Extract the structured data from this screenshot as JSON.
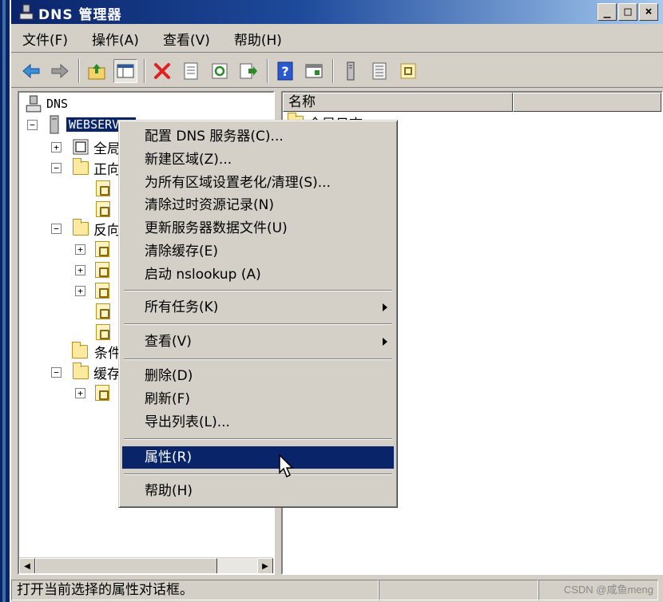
{
  "window": {
    "title": "DNS 管理器",
    "controls": {
      "minimize": "_",
      "maximize": "□",
      "close": "×"
    }
  },
  "menubar": {
    "items": [
      "文件(F)",
      "操作(A)",
      "查看(V)",
      "帮助(H)"
    ]
  },
  "toolbar": {
    "buttons": [
      "back-arrow-icon",
      "forward-arrow-icon",
      "up-folder-icon",
      "show-tree-icon",
      "delete-icon",
      "properties-icon",
      "refresh-icon",
      "export-icon",
      "help-icon",
      "console-icon",
      "server-icon",
      "list-icon",
      "zone-icon"
    ]
  },
  "tree": {
    "root": "DNS",
    "server": "WEBSERVER",
    "items": [
      {
        "label": "全局",
        "kind": "global"
      },
      {
        "label": "正向",
        "kind": "folder"
      },
      {
        "label": "",
        "kind": "zone"
      },
      {
        "label": "",
        "kind": "zone"
      },
      {
        "label": "反向",
        "kind": "folder"
      },
      {
        "label": "",
        "kind": "zone"
      },
      {
        "label": "",
        "kind": "zone"
      },
      {
        "label": "",
        "kind": "zone"
      },
      {
        "label": "",
        "kind": "zone"
      },
      {
        "label": "",
        "kind": "zone"
      },
      {
        "label": "条件",
        "kind": "folder"
      },
      {
        "label": "缓存",
        "kind": "folder"
      },
      {
        "label": "",
        "kind": "zone"
      }
    ]
  },
  "list": {
    "columns": [
      "名称",
      ""
    ],
    "first_row": "全局日志"
  },
  "context_menu": {
    "items": [
      "配置 DNS 服务器(C)...",
      "新建区域(Z)...",
      "为所有区域设置老化/清理(S)...",
      "清除过时资源记录(N)",
      "更新服务器数据文件(U)",
      "清除缓存(E)",
      "启动 nslookup (A)",
      "所有任务(K)",
      "查看(V)",
      "删除(D)",
      "刷新(F)",
      "导出列表(L)...",
      "属性(R)",
      "帮助(H)"
    ],
    "highlighted": "属性(R)"
  },
  "statusbar": {
    "text": "打开当前选择的属性对话框。"
  },
  "watermark": "CSDN @咸鱼meng",
  "colors": {
    "titlebar_start": "#0a246a",
    "selection": "#0a246a",
    "face": "#d4d0c8"
  }
}
